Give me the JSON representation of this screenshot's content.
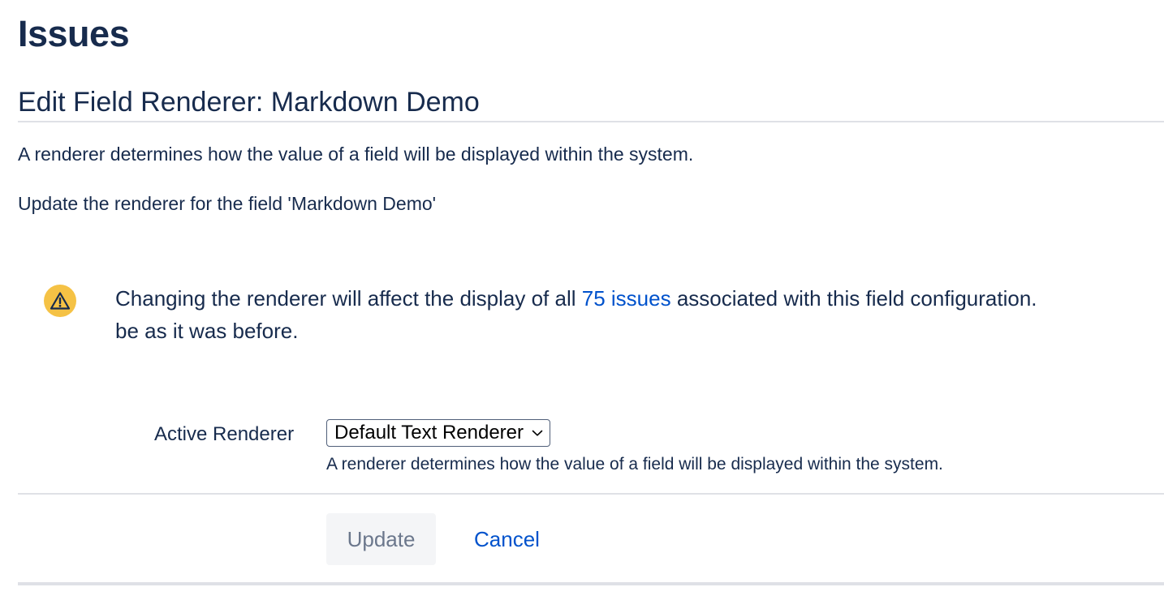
{
  "header": {
    "title": "Issues"
  },
  "section": {
    "title": "Edit Field Renderer: Markdown Demo",
    "description": "A renderer determines how the value of a field will be displayed within the system.",
    "instruction": "Update the renderer for the field 'Markdown Demo'"
  },
  "warning": {
    "icon": "warning-icon",
    "icon_color": "#f5c245",
    "text_before_link": "Changing the renderer will affect the display of all ",
    "link_text": "75 issues",
    "text_after_link": " associated with this field configuration.",
    "second_line": "be as it was before."
  },
  "form": {
    "active_renderer_label": "Active Renderer",
    "active_renderer_value": "Default Text Renderer",
    "active_renderer_help": "A renderer determines how the value of a field will be displayed within the system."
  },
  "buttons": {
    "update_label": "Update",
    "cancel_label": "Cancel"
  },
  "colors": {
    "text": "#172b4d",
    "link": "#0052cc",
    "divider": "#dfe1e6",
    "disabled_button_bg": "#f4f5f7",
    "disabled_button_text": "#6b778c"
  }
}
